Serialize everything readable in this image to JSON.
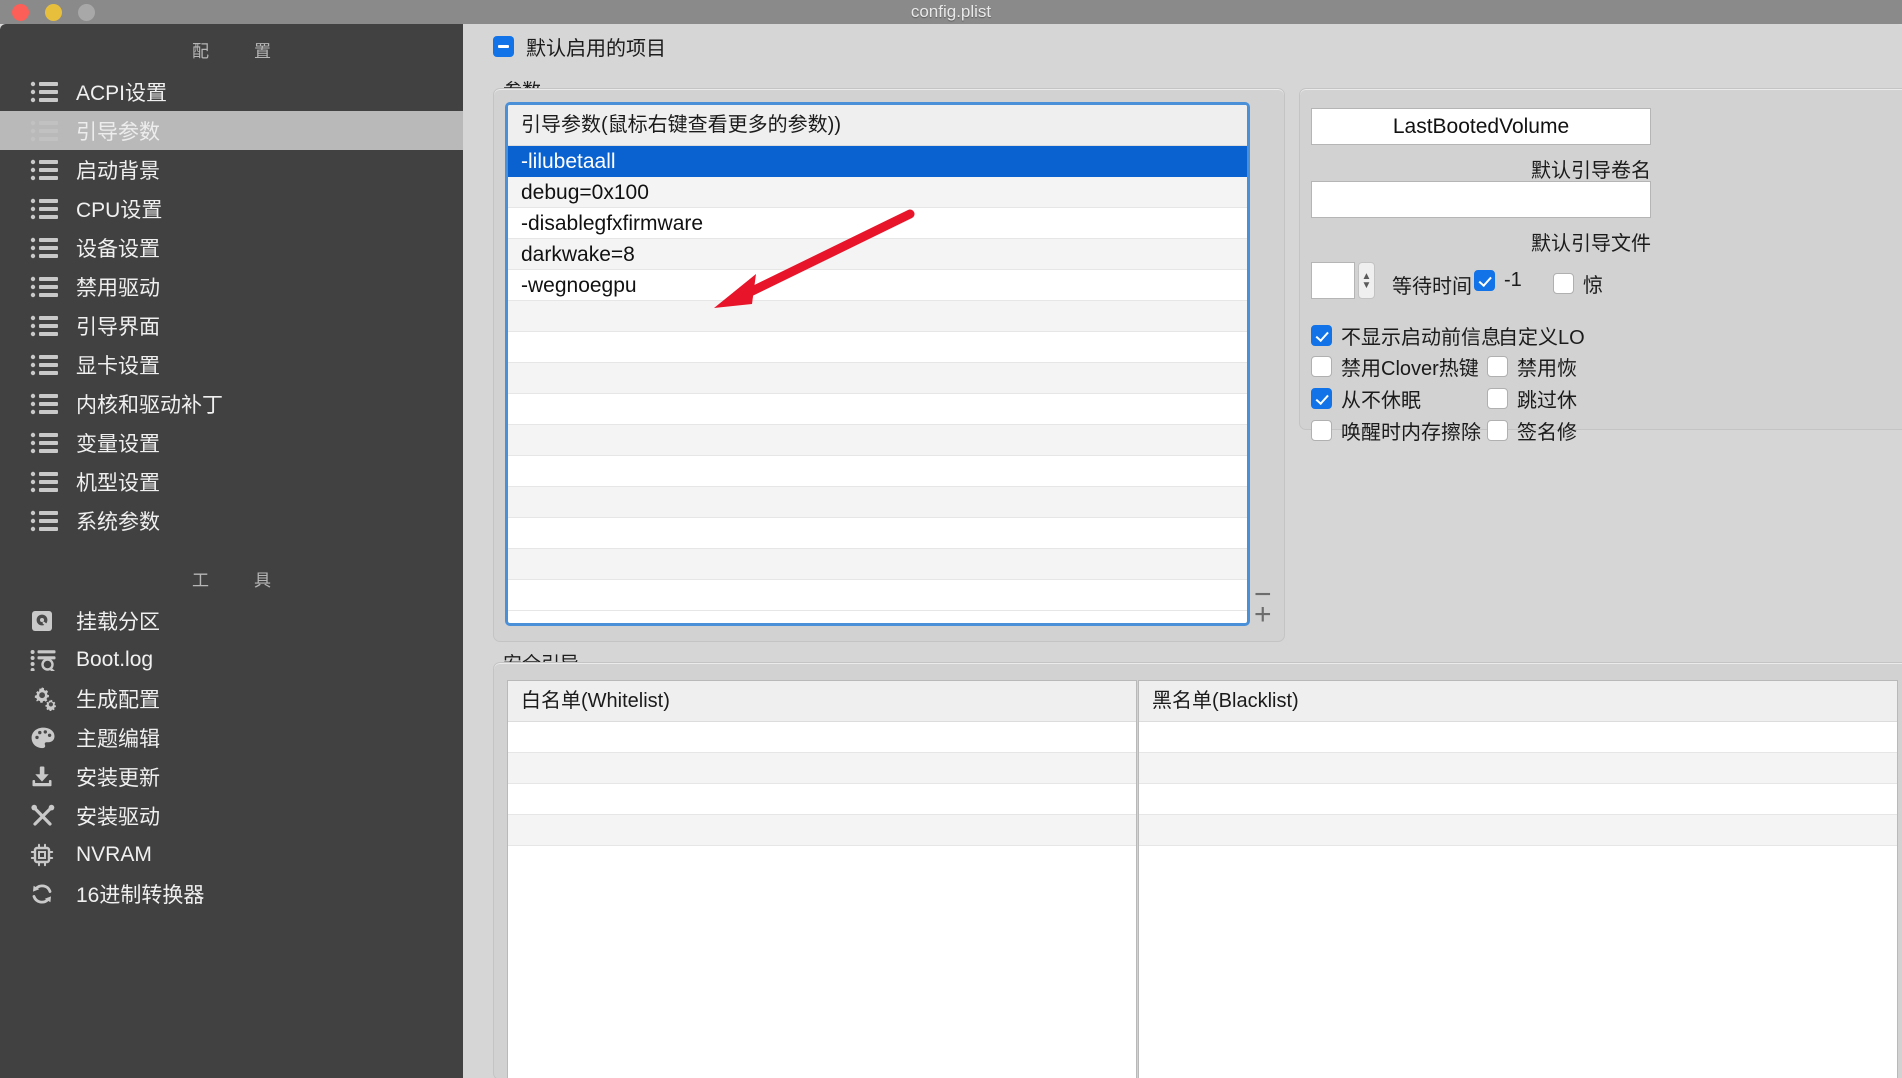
{
  "window": {
    "title": "config.plist",
    "traffic_lights": [
      "close-button",
      "minimize-button",
      "zoom-button"
    ]
  },
  "sidebar": {
    "config_section_title": "配　置",
    "tools_section_title": "工　具",
    "config_items": [
      {
        "label": "ACPI设置",
        "icon": "list-icon",
        "selected": false
      },
      {
        "label": "引导参数",
        "icon": "list-icon",
        "selected": true
      },
      {
        "label": "启动背景",
        "icon": "list-icon",
        "selected": false
      },
      {
        "label": "CPU设置",
        "icon": "list-icon",
        "selected": false
      },
      {
        "label": "设备设置",
        "icon": "list-icon",
        "selected": false
      },
      {
        "label": "禁用驱动",
        "icon": "list-icon",
        "selected": false
      },
      {
        "label": "引导界面",
        "icon": "list-icon",
        "selected": false
      },
      {
        "label": "显卡设置",
        "icon": "list-icon",
        "selected": false
      },
      {
        "label": "内核和驱动补丁",
        "icon": "list-icon",
        "selected": false
      },
      {
        "label": "变量设置",
        "icon": "list-icon",
        "selected": false
      },
      {
        "label": "机型设置",
        "icon": "list-icon",
        "selected": false
      },
      {
        "label": "系统参数",
        "icon": "list-icon",
        "selected": false
      }
    ],
    "tool_items": [
      {
        "label": "挂载分区",
        "icon": "disk-icon"
      },
      {
        "label": "Boot.log",
        "icon": "log-search-icon"
      },
      {
        "label": "生成配置",
        "icon": "gears-icon"
      },
      {
        "label": "主题编辑",
        "icon": "palette-icon"
      },
      {
        "label": "安装更新",
        "icon": "download-icon"
      },
      {
        "label": "安装驱动",
        "icon": "tools-icon"
      },
      {
        "label": "NVRAM",
        "icon": "chip-icon"
      },
      {
        "label": "16进制转换器",
        "icon": "refresh-icon"
      }
    ]
  },
  "main": {
    "disclosure": {
      "label": "默认启用的项目",
      "state": "expanded",
      "icon": "minus-box-icon"
    },
    "params_group_label": "参数",
    "boot_args": {
      "header": "引导参数(鼠标右键查看更多的参数))",
      "rows": [
        "-lilubetaall",
        "debug=0x100",
        "-disablegfxfirmware",
        "darkwake=8",
        "-wegnoegpu",
        "",
        "",
        "",
        "",
        "",
        "",
        "",
        "",
        "",
        ""
      ],
      "selected_index": 0,
      "add_button": "+",
      "remove_button": "−"
    },
    "secure_boot_label": "安全引导",
    "whitelist": {
      "header": "白名单(Whitelist)",
      "rows": [
        "",
        "",
        "",
        ""
      ]
    },
    "blacklist": {
      "header": "黑名单(Blacklist)",
      "rows": [
        "",
        "",
        "",
        ""
      ]
    }
  },
  "right_panel": {
    "default_volume": {
      "value": "LastBootedVolume",
      "caption": "默认引导卷名"
    },
    "default_loader": {
      "value": "",
      "caption": "默认引导文件"
    },
    "timeout": {
      "value": "",
      "label": "等待时间",
      "minus_one_label": "-1",
      "minus_one_checked": true,
      "panic_label": "惊",
      "panic_checked": false
    },
    "checkboxes": [
      {
        "label": "不显示启动前信息",
        "checked": true
      },
      {
        "label": "自定义LO",
        "checked": false,
        "no_box": true
      },
      {
        "label": "禁用Clover热键",
        "checked": false
      },
      {
        "label": "禁用恢",
        "checked": false
      },
      {
        "label": "从不休眠",
        "checked": true
      },
      {
        "label": "跳过休",
        "checked": false
      },
      {
        "label": "唤醒时内存擦除",
        "checked": false
      },
      {
        "label": "签名修",
        "checked": false
      }
    ]
  },
  "annotation": {
    "type": "red-arrow",
    "points_to": "-wegnoegpu"
  },
  "colors": {
    "accent_blue": "#0a62d0",
    "focus_ring": "#4a90d9",
    "checkbox_blue": "#1273e8",
    "sidebar_bg": "#414141",
    "sidebar_selected": "#b9b9b9",
    "content_bg": "#d6d6d6",
    "annotation_red": "#e8152a"
  }
}
